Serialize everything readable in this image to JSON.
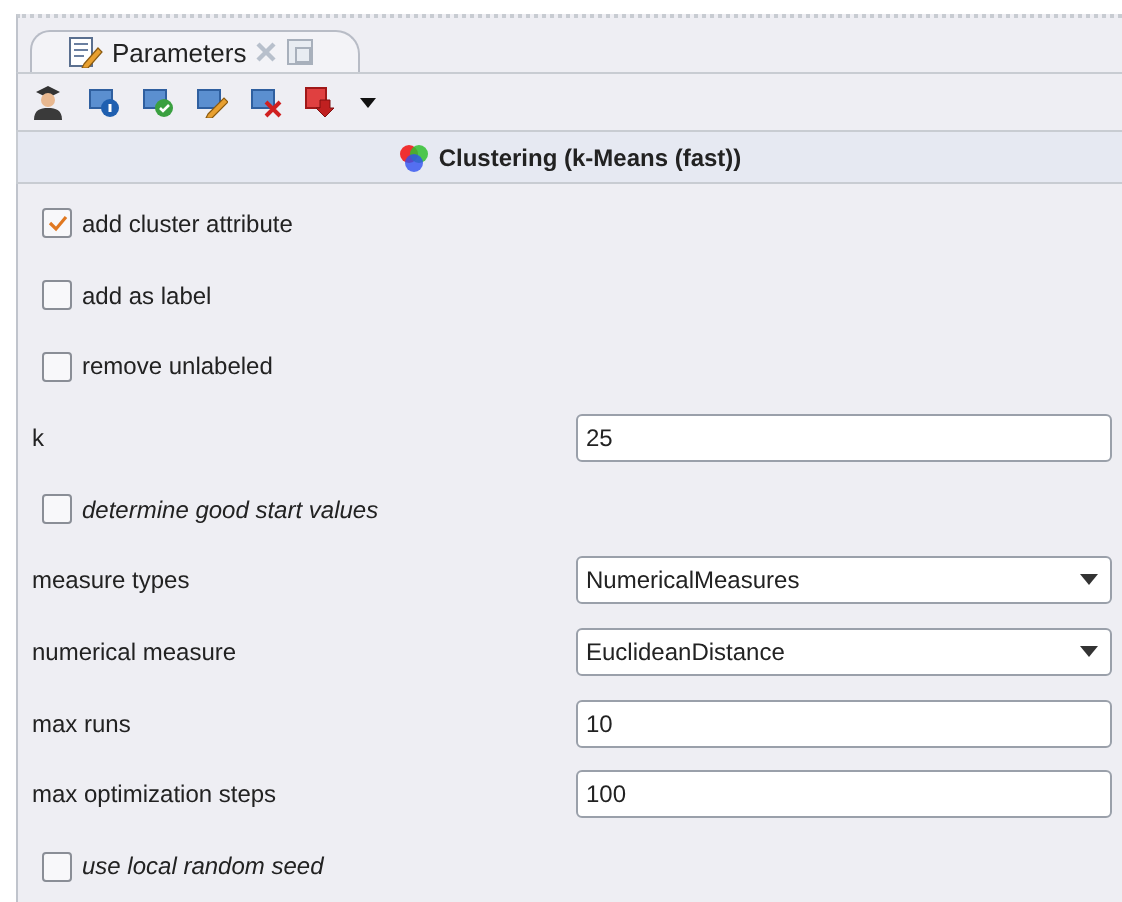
{
  "tab": {
    "label": "Parameters",
    "selected": true
  },
  "header": {
    "title": "Clustering (k-Means (fast))"
  },
  "parameters": [
    {
      "kind": "checkbox",
      "label": "add cluster attribute",
      "checked": true,
      "expert": false
    },
    {
      "kind": "checkbox",
      "label": "add as label",
      "checked": false,
      "expert": false
    },
    {
      "kind": "checkbox",
      "label": "remove unlabeled",
      "checked": false,
      "expert": false
    },
    {
      "kind": "text",
      "label": "k",
      "value": "25"
    },
    {
      "kind": "checkbox",
      "label": "determine good start values",
      "checked": false,
      "expert": true
    },
    {
      "kind": "select",
      "label": "measure types",
      "value": "NumericalMeasures"
    },
    {
      "kind": "select",
      "label": "numerical measure",
      "value": "EuclideanDistance"
    },
    {
      "kind": "text",
      "label": "max runs",
      "value": "10"
    },
    {
      "kind": "text",
      "label": "max optimization steps",
      "value": "100"
    },
    {
      "kind": "checkbox",
      "label": "use local random seed",
      "checked": false,
      "expert": true
    }
  ]
}
